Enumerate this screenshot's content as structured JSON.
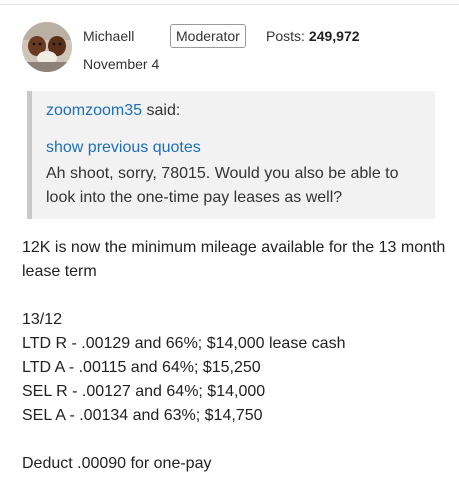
{
  "post": {
    "username": "Michaell",
    "role": "Moderator",
    "posts_label": "Posts:",
    "posts_count": "249,972",
    "date": "November 4"
  },
  "quote": {
    "author": "zoomzoom35",
    "said": "said:",
    "show_previous": "show previous quotes",
    "text": "Ah shoot, sorry, 78015. Would you also be able to look into the one-time pay leases as well?"
  },
  "body": {
    "intro": "12K is now the minimum mileage available for the 13 month lease term",
    "lines": [
      "13/12",
      "LTD R - .00129 and 66%; $14,000 lease cash",
      "LTD A - .00115 and 64%; $15,250",
      "SEL R - .00127 and 64%; $14,000",
      "SEL A - .00134 and 63%; $14,750"
    ],
    "footer": "Deduct .00090 for one-pay"
  }
}
